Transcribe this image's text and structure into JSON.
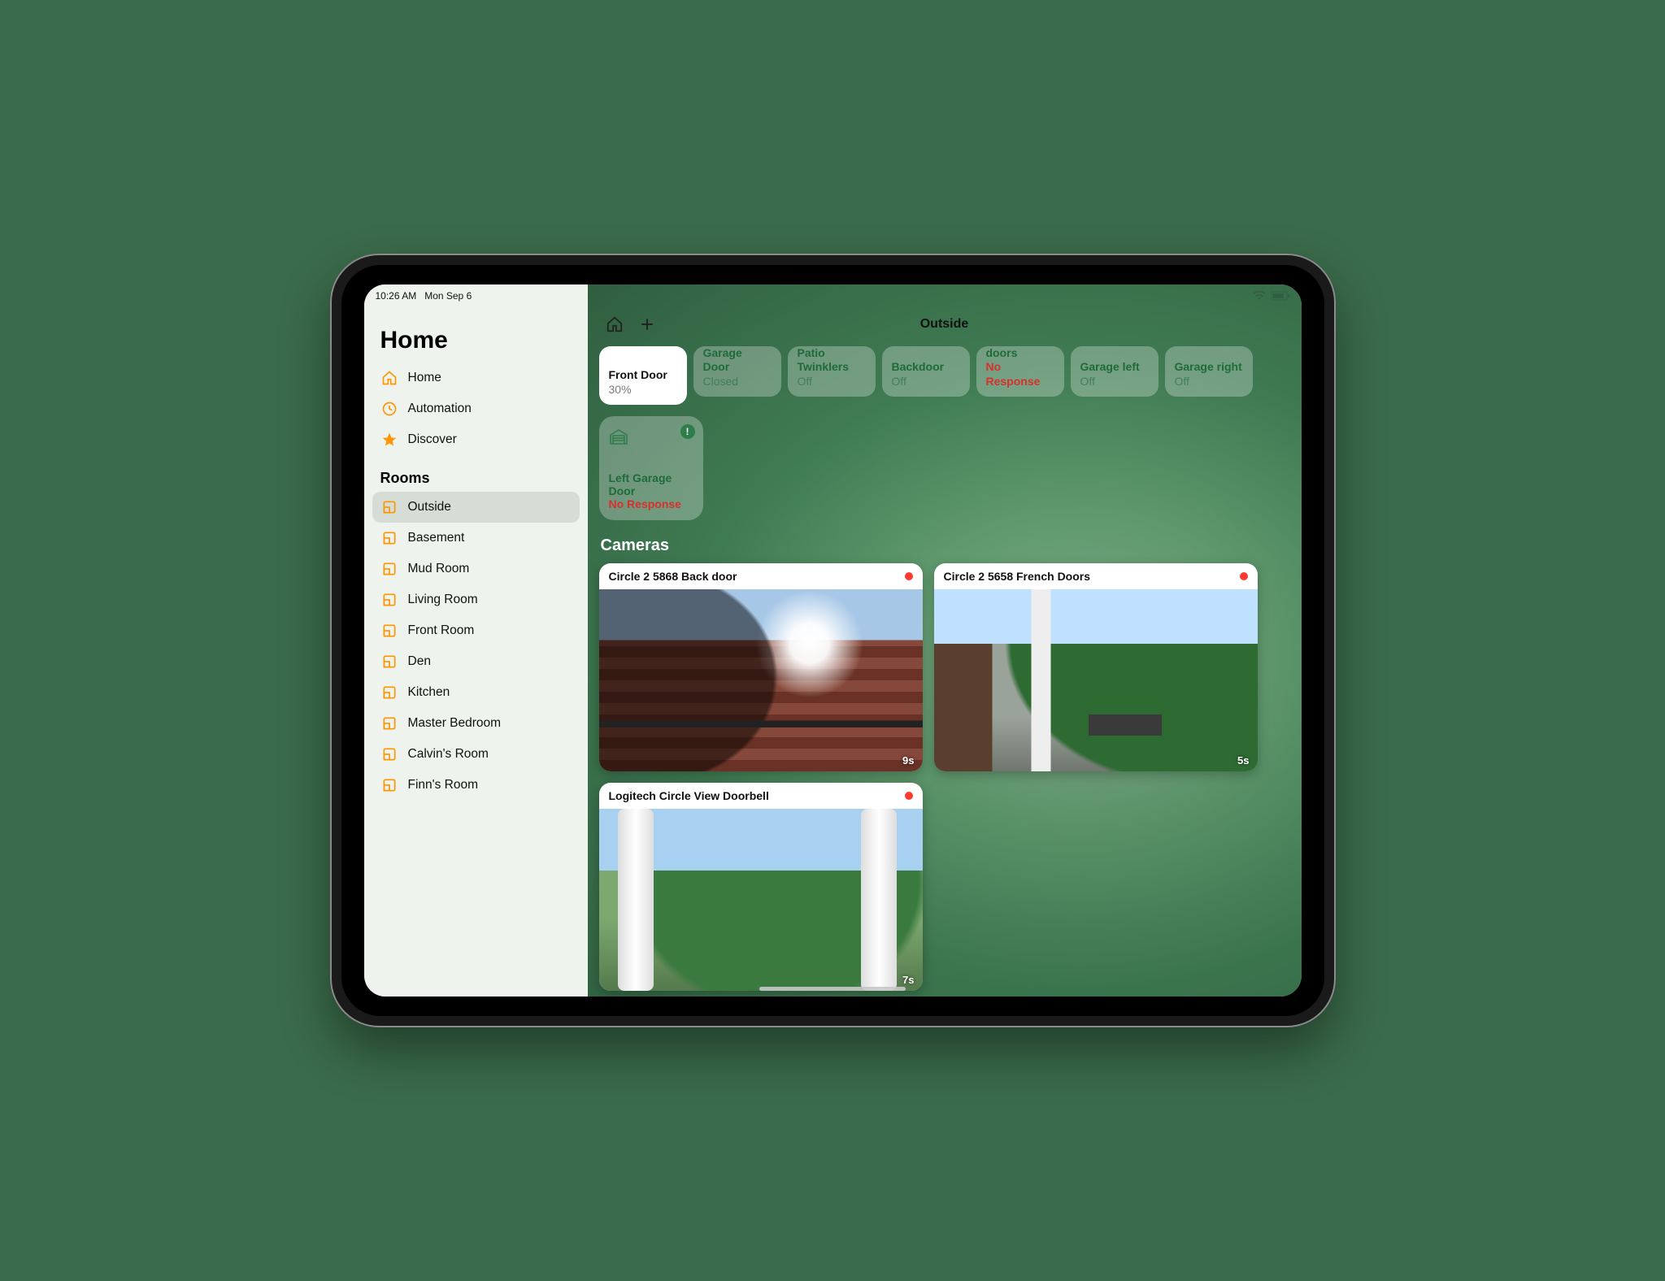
{
  "status": {
    "time": "10:26 AM",
    "date": "Mon Sep 6"
  },
  "sidebar": {
    "title": "Home",
    "nav": [
      {
        "label": "Home",
        "icon": "home-icon"
      },
      {
        "label": "Automation",
        "icon": "clock-icon"
      },
      {
        "label": "Discover",
        "icon": "star-icon"
      }
    ],
    "rooms_header": "Rooms",
    "rooms": [
      {
        "label": "Outside",
        "selected": true
      },
      {
        "label": "Basement",
        "selected": false
      },
      {
        "label": "Mud Room",
        "selected": false
      },
      {
        "label": "Living Room",
        "selected": false
      },
      {
        "label": "Front Room",
        "selected": false
      },
      {
        "label": "Den",
        "selected": false
      },
      {
        "label": "Kitchen",
        "selected": false
      },
      {
        "label": "Master Bedroom",
        "selected": false
      },
      {
        "label": "Calvin's Room",
        "selected": false
      },
      {
        "label": "Finn's Room",
        "selected": false
      }
    ]
  },
  "topbar": {
    "title": "Outside"
  },
  "accessories_row": [
    {
      "name": "Front Door",
      "status": "30%",
      "state": "active"
    },
    {
      "name": "Right Garage Door",
      "status": "Closed",
      "state": "off"
    },
    {
      "name": "Patio Twinklers",
      "status": "Off",
      "state": "off"
    },
    {
      "name": "Backdoor",
      "status": "Off",
      "state": "off"
    },
    {
      "name": "French doors",
      "status": "No Response",
      "state": "err"
    },
    {
      "name": "Garage left",
      "status": "Off",
      "state": "off"
    },
    {
      "name": "Garage right",
      "status": "Off",
      "state": "off"
    }
  ],
  "accessories_large": [
    {
      "name": "Left Garage Door",
      "status": "No Response",
      "state": "err",
      "warn": "!"
    }
  ],
  "cameras_header": "Cameras",
  "cameras": [
    {
      "name": "Circle 2 5868 Back door",
      "age": "9s",
      "scene": "scene-backdoor"
    },
    {
      "name": "Circle 2 5658 French Doors",
      "age": "5s",
      "scene": "scene-french"
    },
    {
      "name": "Logitech Circle View Doorbell",
      "age": "7s",
      "scene": "scene-doorbell"
    }
  ]
}
